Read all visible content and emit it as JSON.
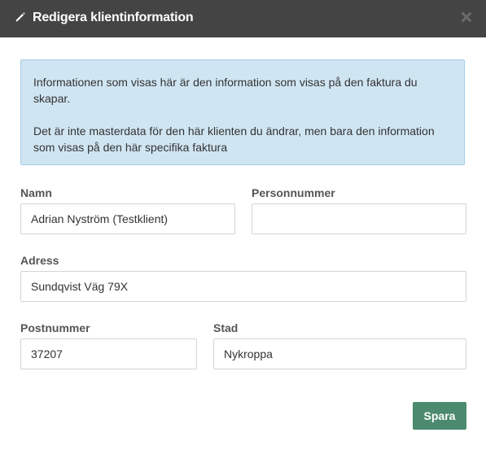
{
  "header": {
    "title": "Redigera klientinformation",
    "icon": "pencil-icon",
    "close_icon": "close-icon",
    "background": "#444444"
  },
  "info": {
    "paragraph_1": "Informationen som visas här är den information som visas på den faktura du skapar.",
    "paragraph_2": "Det är inte masterdata för den här klienten du ändrar, men bara den information som visas på den här specifika faktura",
    "background": "#d0e5f2"
  },
  "form": {
    "name": {
      "label": "Namn",
      "value": "Adrian Nyström (Testklient)"
    },
    "personal_number": {
      "label": "Personnummer",
      "value": ""
    },
    "address": {
      "label": "Adress",
      "value": "Sundqvist Väg 79X"
    },
    "postal_code": {
      "label": "Postnummer",
      "value": "37207"
    },
    "city": {
      "label": "Stad",
      "value": "Nykroppa"
    }
  },
  "actions": {
    "save_label": "Spara",
    "save_color": "#4b8a6e"
  }
}
